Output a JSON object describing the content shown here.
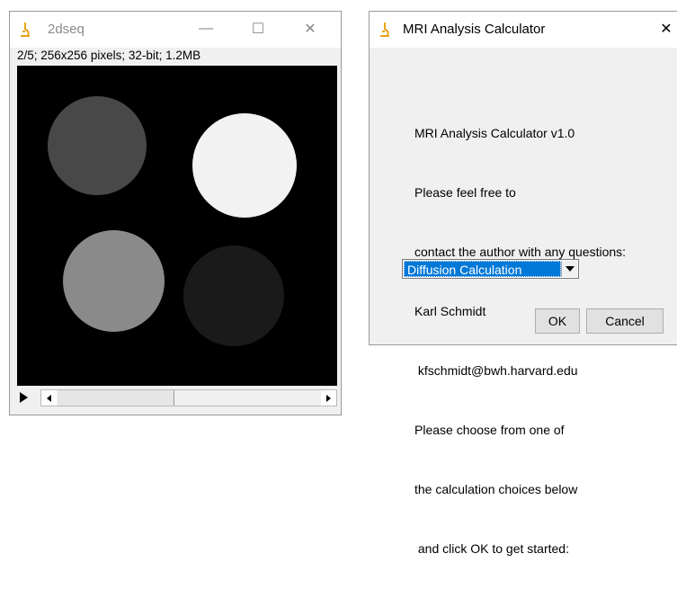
{
  "image_window": {
    "title": "2dseq",
    "info": "2/5; 256x256 pixels; 32-bit; 1.2MB",
    "controls": {
      "minimize": "—",
      "maximize": "☐",
      "close": "✕"
    },
    "disks": [
      {
        "label": "top-left",
        "color": "#484848"
      },
      {
        "label": "top-right",
        "color": "#f2f2f2"
      },
      {
        "label": "bottom-left",
        "color": "#8a8a8a"
      },
      {
        "label": "bottom-right",
        "color": "#1a1a1a"
      }
    ]
  },
  "dialog": {
    "title": "MRI Analysis Calculator",
    "close": "✕",
    "message_lines": [
      "MRI Analysis Calculator v1.0",
      "Please feel free to",
      "contact the author with any questions:",
      "Karl Schmidt",
      " kfschmidt@bwh.harvard.edu",
      "Please choose from one of",
      "the calculation choices below",
      " and click OK to get started:"
    ],
    "selected_option": "Diffusion Calculation",
    "ok_label": "OK",
    "cancel_label": "Cancel"
  },
  "colors": {
    "selection": "#0078d7",
    "icon_orange": "#e8a317"
  }
}
